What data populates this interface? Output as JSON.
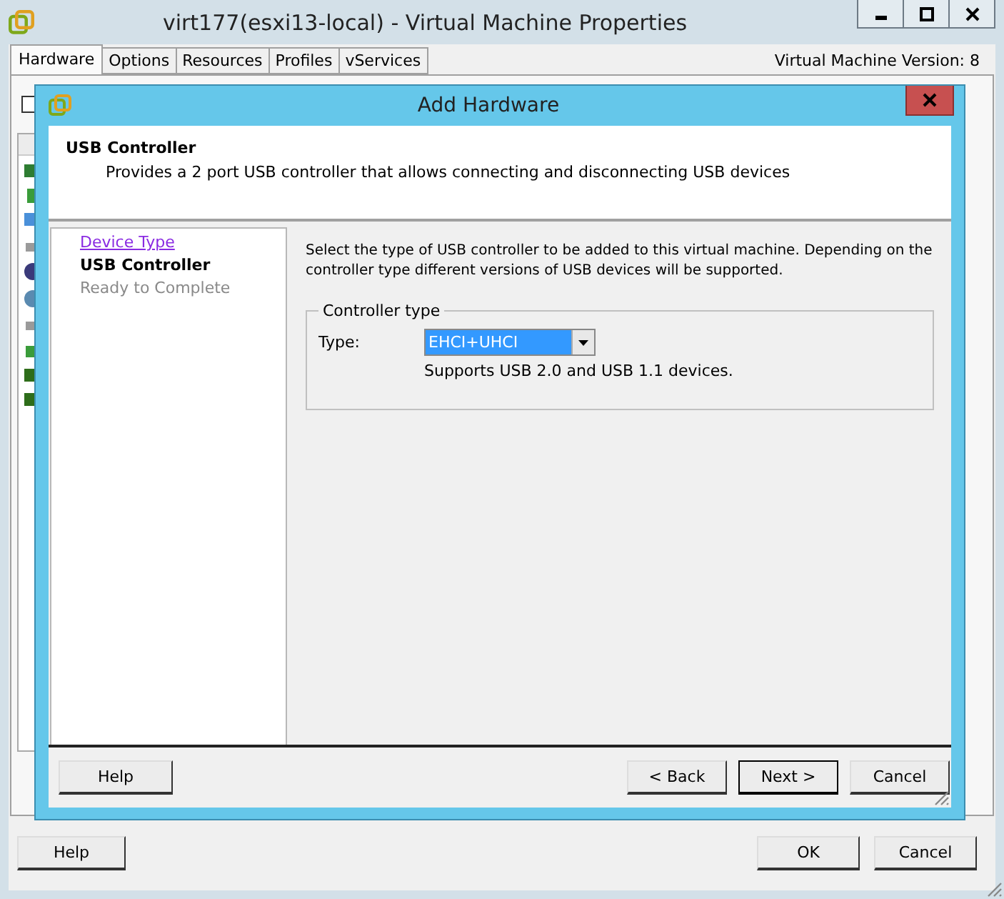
{
  "window": {
    "title": "virt177(esxi13-local) - Virtual Machine Properties"
  },
  "tabs": [
    {
      "label": "Hardware",
      "selected": true
    },
    {
      "label": "Options",
      "selected": false
    },
    {
      "label": "Resources",
      "selected": false
    },
    {
      "label": "Profiles",
      "selected": false
    },
    {
      "label": "vServices",
      "selected": false
    }
  ],
  "version_label": "Virtual Machine Version: 8",
  "background": {
    "checkbox_checked": false
  },
  "dialog": {
    "title": "Add Hardware",
    "header": {
      "title": "USB Controller",
      "description": "Provides a 2 port USB controller that allows connecting and disconnecting USB devices"
    },
    "steps": [
      {
        "label": "Device Type",
        "kind": "visited"
      },
      {
        "label": "USB Controller",
        "kind": "current"
      },
      {
        "label": "Ready to Complete",
        "kind": "pending"
      }
    ],
    "intro": "Select the type of USB controller to be added to this virtual machine. Depending on the controller type different versions of USB devices will be supported.",
    "group": {
      "legend": "Controller type",
      "field_label": "Type:",
      "value": "EHCI+UHCI",
      "hint": "Supports USB 2.0 and USB 1.1 devices."
    },
    "buttons": [
      {
        "label": "Help",
        "kind": "help",
        "default": false
      },
      {
        "label": "< Back",
        "kind": "nav",
        "default": false
      },
      {
        "label": "Next >",
        "kind": "nav",
        "default": true
      },
      {
        "label": "Cancel",
        "kind": "nav",
        "default": false
      }
    ]
  },
  "footer_buttons": [
    {
      "label": "Help",
      "kind": "help"
    },
    {
      "label": "OK",
      "kind": "nav"
    },
    {
      "label": "Cancel",
      "kind": "nav"
    }
  ]
}
